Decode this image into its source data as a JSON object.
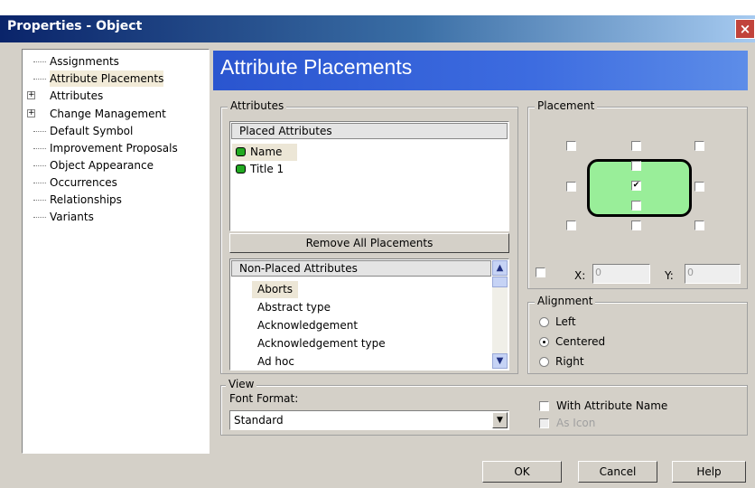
{
  "window": {
    "title": "Properties - Object",
    "close_glyph": "×"
  },
  "tree": {
    "items": [
      {
        "label": "Assignments",
        "expandable": false
      },
      {
        "label": "Attribute Placements",
        "expandable": false,
        "selected": true
      },
      {
        "label": "Attributes",
        "expandable": true
      },
      {
        "label": "Change Management",
        "expandable": true
      },
      {
        "label": "Default Symbol",
        "expandable": false
      },
      {
        "label": "Improvement Proposals",
        "expandable": false
      },
      {
        "label": "Object Appearance",
        "expandable": false
      },
      {
        "label": "Occurrences",
        "expandable": false
      },
      {
        "label": "Relationships",
        "expandable": false
      },
      {
        "label": "Variants",
        "expandable": false
      }
    ],
    "expand_glyph": "+"
  },
  "banner": {
    "title": "Attribute Placements"
  },
  "attributes": {
    "group_label": "Attributes",
    "placed_header": "Placed Attributes",
    "placed": [
      "Name",
      "Title 1"
    ],
    "remove_all_label": "Remove All Placements",
    "nonplaced_header": "Non-Placed Attributes",
    "nonplaced": [
      "Aborts",
      "Abstract type",
      "Acknowledgement",
      "Acknowledgement type",
      "Ad hoc"
    ]
  },
  "placement": {
    "group_label": "Placement",
    "check_glyph": "✔",
    "x_label": "X:",
    "x_value": "0",
    "y_label": "Y:",
    "y_value": "0"
  },
  "alignment": {
    "group_label": "Alignment",
    "options": [
      "Left",
      "Centered",
      "Right"
    ],
    "selected": "Centered"
  },
  "view": {
    "group_label": "View",
    "font_format_label": "Font Format:",
    "font_format_value": "Standard",
    "with_attribute_name": "With Attribute Name",
    "as_icon": "As Icon"
  },
  "buttons": {
    "ok": "OK",
    "cancel": "Cancel",
    "help": "Help"
  },
  "colors": {
    "title_bar": "#0a246a",
    "banner": "#2a55cf",
    "symbol_fill": "#99ee99"
  },
  "icons": {
    "scroll_up": "▲",
    "scroll_down": "▼",
    "dropdown": "▼"
  }
}
